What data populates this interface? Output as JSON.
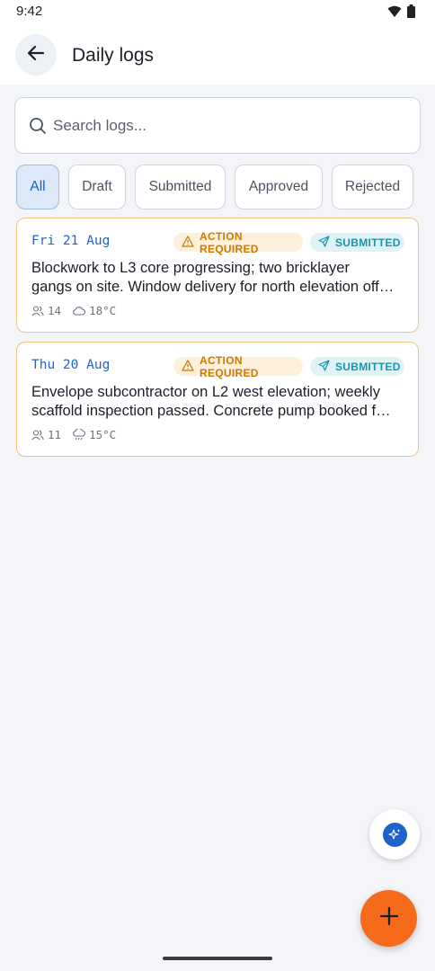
{
  "status": {
    "time": "9:42"
  },
  "header": {
    "title": "Daily logs"
  },
  "search": {
    "placeholder": "Search logs..."
  },
  "filters": [
    {
      "label": "All",
      "active": true
    },
    {
      "label": "Draft",
      "active": false
    },
    {
      "label": "Submitted",
      "active": false
    },
    {
      "label": "Approved",
      "active": false
    },
    {
      "label": "Rejected",
      "active": false
    }
  ],
  "logs": [
    {
      "date": "Fri 21 Aug",
      "badge_warning": "ACTION REQUIRED",
      "badge_status": "SUBMITTED",
      "line1": "Blockwork to L3 core progressing; two bricklayer",
      "line2": "gangs on site. Window delivery for north elevation off…",
      "workers": "14",
      "temperature": "18°C",
      "weather_icon": "cloud-icon"
    },
    {
      "date": "Thu 20 Aug",
      "badge_warning": "ACTION REQUIRED",
      "badge_status": "SUBMITTED",
      "line1": "Envelope subcontractor on L2 west elevation; weekly",
      "line2": "scaffold inspection passed. Concrete pump booked f…",
      "workers": "11",
      "temperature": "15°C",
      "weather_icon": "rain-cloud-icon"
    }
  ],
  "colors": {
    "accent": "#1f62c9",
    "warning": "#cc7a00",
    "submitted": "#1a95ad",
    "fab": "#f66a1c"
  }
}
